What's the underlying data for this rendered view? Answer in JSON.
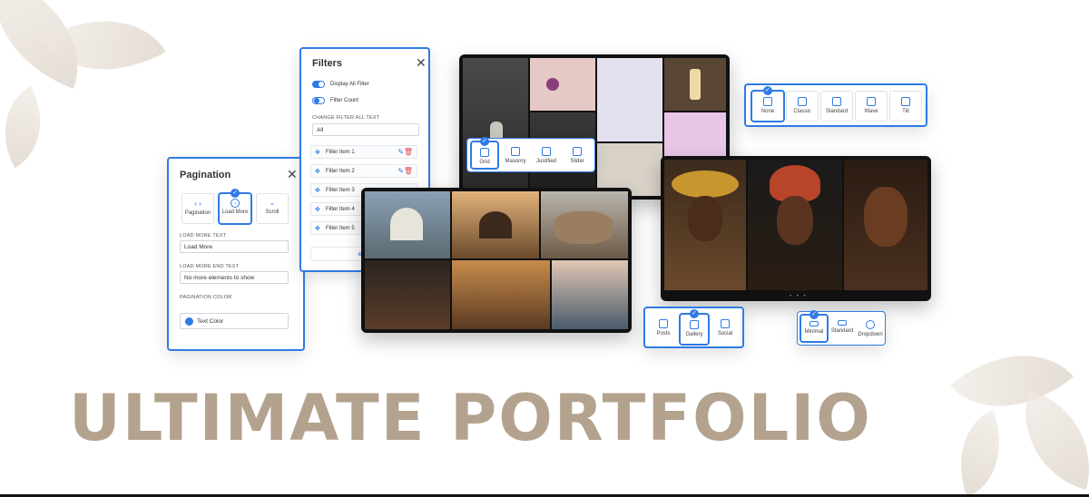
{
  "headline": "ULTIMATE PORTFOLIO",
  "pagination": {
    "title": "Pagination",
    "options": [
      "Pagination",
      "Load More",
      "Scroll"
    ],
    "selected": "Load More",
    "load_more_text_label": "LOAD MORE TEXT",
    "load_more_text_value": "Load More",
    "load_more_end_text_label": "LOAD MORE END TEXT",
    "load_more_end_text_value": "No more elements to show",
    "color_label": "PAGINATION COLOR",
    "color_value": "Text Color",
    "color_swatch": "#2f7be5"
  },
  "filters": {
    "title": "Filters",
    "display_all_label": "Display All Filter",
    "display_all_on": true,
    "filter_count_label": "Filter Count",
    "filter_count_on": false,
    "change_all_label": "CHANGE FILTER ALL TEXT",
    "change_all_value": "All",
    "items": [
      "Filter Item 1",
      "Filter Item 2",
      "Filter Item 3",
      "Filter Item 4",
      "Filter Item 5"
    ],
    "add_label": "Ad"
  },
  "layout_picker": {
    "options": [
      "Grid",
      "Masonry",
      "Justified",
      "Slider"
    ],
    "selected": "Grid"
  },
  "hover_picker": {
    "options": [
      "None",
      "Classic",
      "Standard",
      "Wave",
      "Tilt"
    ],
    "selected": "None"
  },
  "type_picker": {
    "options": [
      "Posts",
      "Gallery",
      "Social"
    ],
    "selected": "Gallery"
  },
  "filter_style_picker": {
    "options": [
      "Minimal",
      "Standard",
      "Dropdown"
    ],
    "selected": "Minimal"
  },
  "colors": {
    "accent": "#2f7be5",
    "headline": "#b3a28e"
  }
}
